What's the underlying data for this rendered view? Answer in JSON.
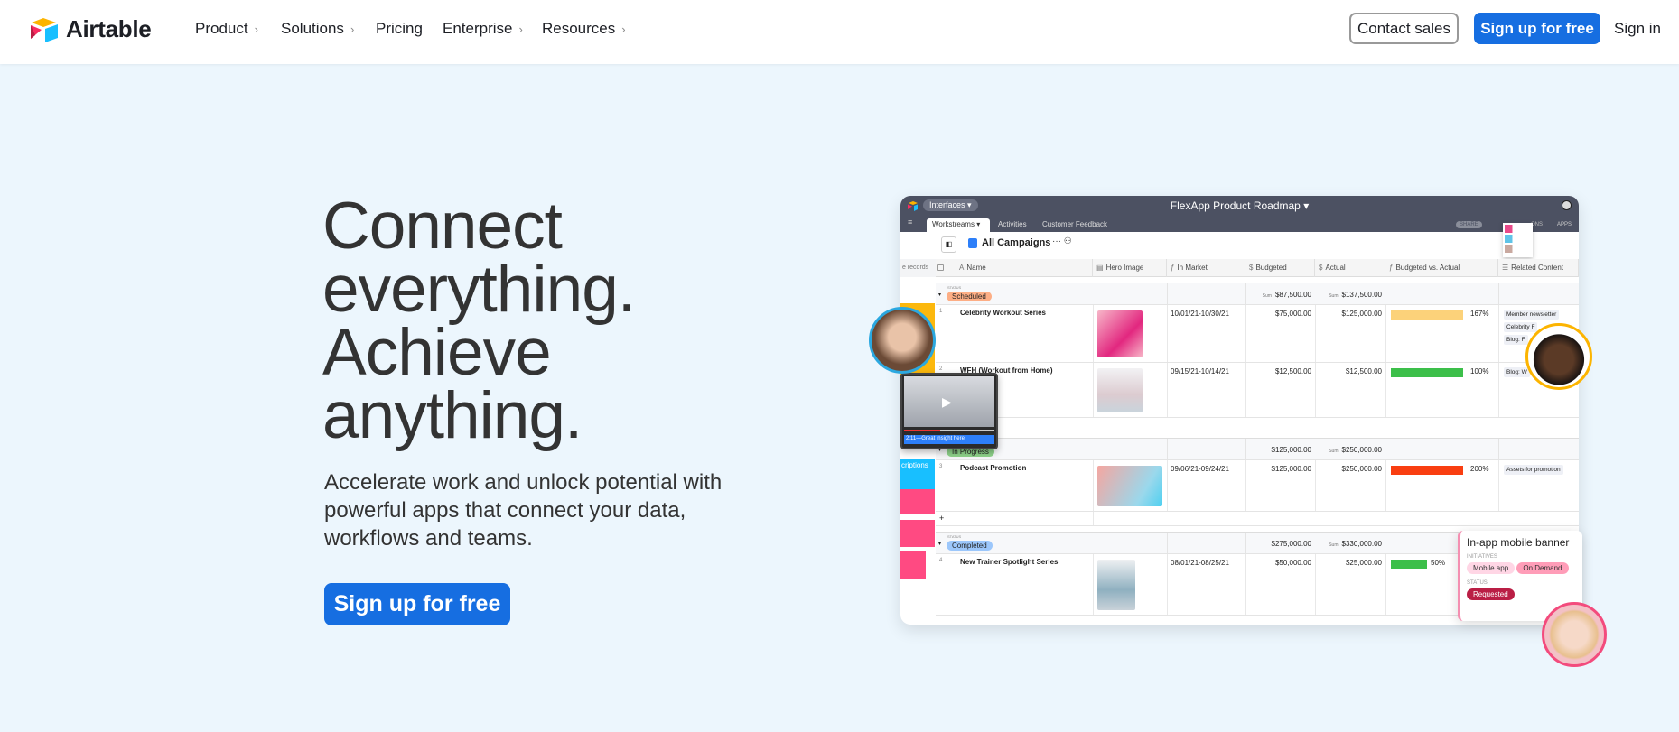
{
  "nav": {
    "brand": "Airtable",
    "items": [
      {
        "label": "Product",
        "chevron": true
      },
      {
        "label": "Solutions",
        "chevron": true
      },
      {
        "label": "Pricing",
        "chevron": false
      },
      {
        "label": "Enterprise",
        "chevron": true
      },
      {
        "label": "Resources",
        "chevron": true
      }
    ],
    "contact_sales": "Contact sales",
    "signup": "Sign up for free",
    "signin": "Sign in"
  },
  "hero": {
    "headline": [
      "Connect",
      "everything.",
      "Achieve",
      "anything."
    ],
    "subtext": "Accelerate work and unlock potential with powerful apps that connect your data, workflows and teams.",
    "cta": "Sign up for free"
  },
  "colors": {
    "primary": "#166ee1",
    "titlebar": "#4c5162",
    "background": "#ecf6fd"
  },
  "mockup": {
    "interfaces": "Interfaces ▾",
    "title": "FlexApp Product Roadmap ▾",
    "tabs": [
      "Workstreams ▾",
      "Activities",
      "Customer Feedback"
    ],
    "share": "SHARE",
    "extensions": "ONS",
    "apps": "APPS",
    "view_name": "All Campaigns",
    "left_hint": "e records",
    "sidebar_card": "criptions",
    "video_caption": "2:11—Great insight here",
    "columns": [
      {
        "icon": "text-icon",
        "label": "Name"
      },
      {
        "icon": "attachment-icon",
        "label": "Hero Image"
      },
      {
        "icon": "formula-icon",
        "label": "In Market"
      },
      {
        "icon": "currency-icon",
        "label": "Budgeted"
      },
      {
        "icon": "currency-icon",
        "label": "Actual"
      },
      {
        "icon": "formula-icon",
        "label": "Budgeted vs. Actual"
      },
      {
        "icon": "list-icon",
        "label": "Related Content"
      }
    ],
    "status_label": "STATUS",
    "sum_label": "Sum",
    "add_row": "+",
    "groups": [
      {
        "status": "Scheduled",
        "color": "#fdae85",
        "budget_sum": "$87,500.00",
        "budget_sum_label": true,
        "actual_sum": "$137,500.00",
        "rows": [
          {
            "num": "1",
            "name": "Celebrity Workout Series",
            "in_market": "10/01/21-10/30/21",
            "budgeted": "$75,000.00",
            "actual": "$125,000.00",
            "pct": 167,
            "pct_label": "167%",
            "bar_color": "#fcd27a",
            "related": [
              "Member newsletter",
              "Celebrity F",
              "Blog: F"
            ],
            "image": "pink"
          },
          {
            "num": "2",
            "name": "WFH (Workout from Home)",
            "in_market": "09/15/21-10/14/21",
            "budgeted": "$12,500.00",
            "actual": "$12,500.00",
            "pct": 100,
            "pct_label": "100%",
            "bar_color": "#3cbf4a",
            "related": [
              "Blog: W"
            ],
            "image": "room"
          }
        ]
      },
      {
        "status": "In Progress",
        "color": "#8fd48b",
        "budget_sum": "$125,000.00",
        "budget_sum_label": false,
        "actual_sum": "$250,000.00",
        "rows": [
          {
            "num": "3",
            "name": "Podcast Promotion",
            "in_market": "09/06/21-09/24/21",
            "budgeted": "$125,000.00",
            "actual": "$250,000.00",
            "pct": 200,
            "pct_label": "200%",
            "bar_color": "#f93e11",
            "related": [
              "Assets for promotion"
            ],
            "image": "gradient"
          }
        ]
      },
      {
        "status": "Completed",
        "color": "#9cc7fb",
        "budget_sum": "$275,000.00",
        "budget_sum_label": false,
        "actual_sum": "$330,000.00",
        "rows": [
          {
            "num": "4",
            "name": "New Trainer Spotlight Series",
            "in_market": "08/01/21-08/25/21",
            "budgeted": "$50,000.00",
            "actual": "$25,000.00",
            "pct": 50,
            "pct_label": "50%",
            "bar_color": "#3cbf4a",
            "related": [],
            "image": "grey"
          }
        ]
      }
    ],
    "popup": {
      "title": "In-app mobile banner",
      "initiatives_label": "INITIATIVES",
      "initiatives": [
        "Mobile app",
        "On Demand"
      ],
      "status_label": "STATUS",
      "status": "Requested"
    }
  }
}
